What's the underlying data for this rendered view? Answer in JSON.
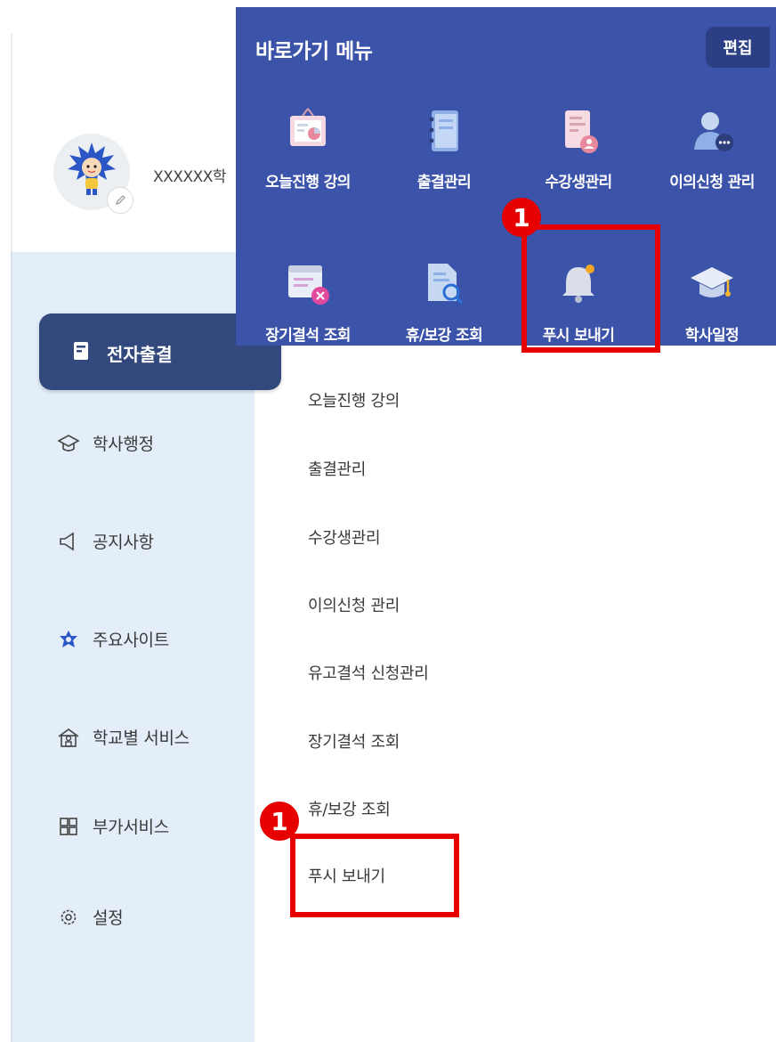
{
  "user": {
    "name": "XXXXXX학"
  },
  "shortcut_panel": {
    "title": "바로가기 메뉴",
    "edit_label": "편집",
    "tiles": [
      {
        "label": "오늘진행 강의",
        "icon": "lecture-board-icon"
      },
      {
        "label": "출결관리",
        "icon": "notebook-icon"
      },
      {
        "label": "수강생관리",
        "icon": "student-list-icon"
      },
      {
        "label": "이의신청 관리",
        "icon": "person-more-icon"
      },
      {
        "label": "장기결석 조회",
        "icon": "window-cancel-icon"
      },
      {
        "label": "휴/보강 조회",
        "icon": "document-search-icon"
      },
      {
        "label": "푸시 보내기",
        "icon": "bell-icon"
      },
      {
        "label": "학사일정",
        "icon": "graduation-cap-icon"
      }
    ]
  },
  "sidebar": {
    "items": [
      {
        "label": "전자출결",
        "icon": "attendance-icon",
        "active": true
      },
      {
        "label": "학사행정",
        "icon": "mortarboard-icon"
      },
      {
        "label": "공지사항",
        "icon": "megaphone-icon"
      },
      {
        "label": "주요사이트",
        "icon": "star-emblem-icon"
      },
      {
        "label": "학교별 서비스",
        "icon": "school-icon"
      },
      {
        "label": "부가서비스",
        "icon": "grid-icon"
      },
      {
        "label": "설정",
        "icon": "gear-icon"
      }
    ]
  },
  "submenu": {
    "items": [
      "오늘진행 강의",
      "출결관리",
      "수강생관리",
      "이의신청 관리",
      "유고결석 신청관리",
      "장기결석 조회",
      "휴/보강 조회",
      "푸시 보내기"
    ]
  },
  "annotations": {
    "badge_top": "1",
    "badge_bottom": "1"
  },
  "colors": {
    "panel": "#3b53a9",
    "active_menu": "#33487c",
    "sidebar": "#e3eef9",
    "highlight": "#e60000"
  }
}
